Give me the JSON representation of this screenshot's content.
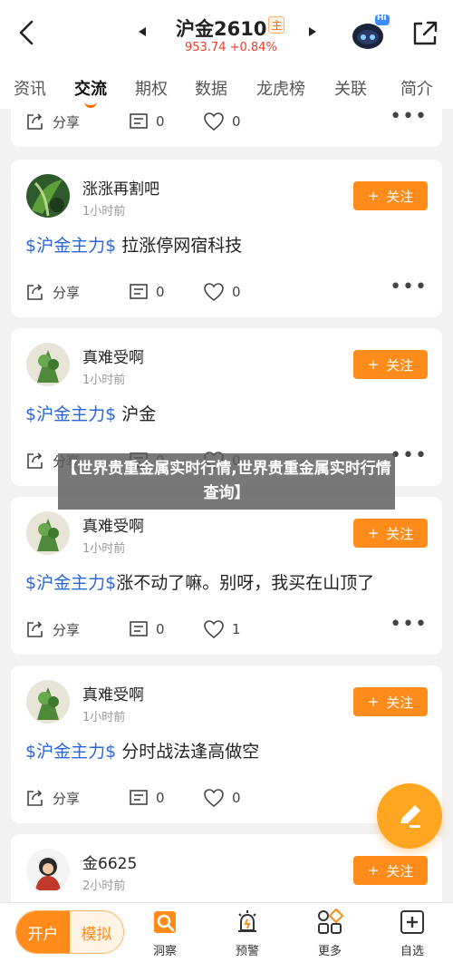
{
  "header": {
    "title": "沪金2610",
    "title_badge": "主",
    "subtitle": "953.74 +0.84%",
    "robot_badge": "Hi"
  },
  "tabs": [
    {
      "label": "资讯",
      "active": false
    },
    {
      "label": "交流",
      "active": true
    },
    {
      "label": "期权",
      "active": false
    },
    {
      "label": "数据",
      "active": false
    },
    {
      "label": "龙虎榜",
      "active": false
    },
    {
      "label": "关联",
      "active": false
    },
    {
      "label": "简介",
      "active": false
    }
  ],
  "posts": [
    {
      "user": "",
      "time": "",
      "tag": "",
      "text": "",
      "share_label": "分享",
      "comments": "0",
      "likes": "0"
    },
    {
      "user": "涨涨再割吧",
      "time": "1小时前",
      "tag": "$沪金主力$",
      "text": " 拉涨停网宿科技",
      "follow_label": "关注",
      "share_label": "分享",
      "comments": "0",
      "likes": "0"
    },
    {
      "user": "真难受啊",
      "time": "1小时前",
      "tag": "$沪金主力$",
      "text": " 沪金",
      "follow_label": "关注",
      "share_label": "分享",
      "comments": "0",
      "likes": "0"
    },
    {
      "user": "真难受啊",
      "time": "1小时前",
      "tag": "$沪金主力$",
      "text": "涨不动了嘛。别呀，我买在山顶了",
      "follow_label": "关注",
      "share_label": "分享",
      "comments": "0",
      "likes": "1"
    },
    {
      "user": "真难受啊",
      "time": "1小时前",
      "tag": "$沪金主力$",
      "text": " 分时战法逢高做空",
      "follow_label": "关注",
      "share_label": "分享",
      "comments": "0",
      "likes": "0"
    },
    {
      "user": "金6625",
      "time": "2小时前",
      "follow_label": "关注"
    }
  ],
  "overlay_text": "【世界贵重金属实时行情,世界贵重金属实时行情查询】",
  "bottom": {
    "open_label": "开户",
    "sim_label": "模拟",
    "nav": [
      {
        "label": "洞察",
        "icon": "insight-icon"
      },
      {
        "label": "预警",
        "icon": "alarm-icon"
      },
      {
        "label": "更多",
        "icon": "grid-icon"
      },
      {
        "label": "自选",
        "icon": "add-box-icon"
      }
    ]
  },
  "colors": {
    "accent": "#ff8c1a",
    "tag_blue": "#2a66d8",
    "price_red": "#e8402f"
  }
}
